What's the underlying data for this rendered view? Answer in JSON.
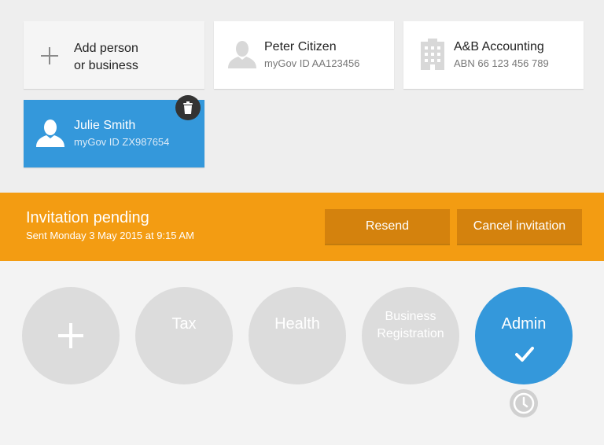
{
  "people": {
    "add_card": {
      "line1": "Add person",
      "line2": "or business"
    },
    "cards": [
      {
        "name": "Peter Citizen",
        "detail": "myGov ID AA123456",
        "icon": "person-icon"
      },
      {
        "name": "A&B Accounting",
        "detail": "ABN 66 123 456 789",
        "icon": "building-icon"
      },
      {
        "name": "Julie Smith",
        "detail": "myGov ID ZX987654",
        "icon": "person-icon",
        "selected": true
      }
    ]
  },
  "banner": {
    "title": "Invitation pending",
    "subtitle": "Sent Monday 3 May 2015 at 9:15 AM",
    "resend_label": "Resend",
    "cancel_label": "Cancel invitation"
  },
  "services": [
    {
      "label": "",
      "icon": "plus-icon"
    },
    {
      "label": "Tax"
    },
    {
      "label": "Health"
    },
    {
      "label_line1": "Business",
      "label_line2": "Registration"
    },
    {
      "label": "Admin",
      "selected": true,
      "icon": "checkmark-icon",
      "status_icon": "clock-icon"
    }
  ],
  "colors": {
    "accent": "#3498db",
    "banner": "#f39c12",
    "banner_button": "#d4820d",
    "inactive_circle": "#dcdcdc"
  }
}
